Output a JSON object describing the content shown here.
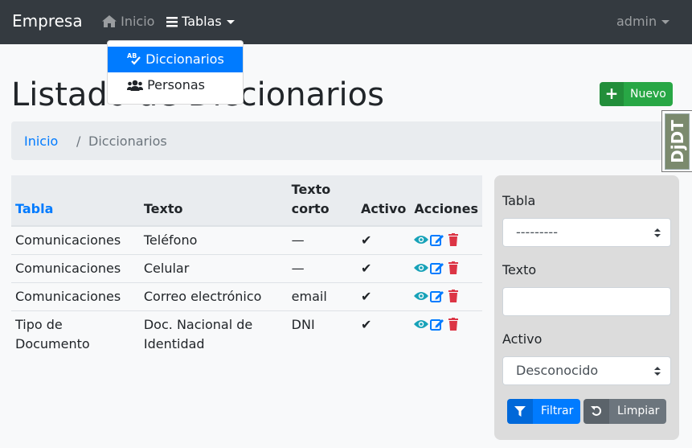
{
  "navbar": {
    "brand": "Empresa",
    "inicio": "Inicio",
    "tablas": "Tablas",
    "user": "admin"
  },
  "dropdown": {
    "items": [
      {
        "label": "Diccionarios",
        "icon": "spell-check-icon",
        "active": true
      },
      {
        "label": "Personas",
        "icon": "users-icon",
        "active": false
      }
    ]
  },
  "page": {
    "title": "Listado de Diccionarios",
    "new_button": "Nuevo"
  },
  "breadcrumb": {
    "home": "Inicio",
    "separator": "/",
    "current": "Diccionarios"
  },
  "djdt": {
    "label": "DjDT"
  },
  "table": {
    "headers": [
      "Tabla",
      "Texto",
      "Texto corto",
      "Activo",
      "Acciones"
    ],
    "rows": [
      {
        "tabla": "Comunicaciones",
        "texto": "Teléfono",
        "corto": "—",
        "activo": "✔"
      },
      {
        "tabla": "Comunicaciones",
        "texto": "Celular",
        "corto": "—",
        "activo": "✔"
      },
      {
        "tabla": "Comunicaciones",
        "texto": "Correo electrónico",
        "corto": "email",
        "activo": "✔"
      },
      {
        "tabla": "Tipo de Documento",
        "texto": "Doc. Nacional de Identidad",
        "corto": "DNI",
        "activo": "✔"
      }
    ]
  },
  "filter": {
    "tabla_label": "Tabla",
    "tabla_value": "---------",
    "texto_label": "Texto",
    "texto_value": "",
    "activo_label": "Activo",
    "activo_value": "Desconocido",
    "filter_button": "Filtrar",
    "clear_button": "Limpiar"
  },
  "colors": {
    "navbar": "#343a40",
    "primary": "#007bff",
    "success": "#28a745",
    "info": "#17a2b8",
    "danger": "#dc3545",
    "secondary": "#6c757d"
  }
}
